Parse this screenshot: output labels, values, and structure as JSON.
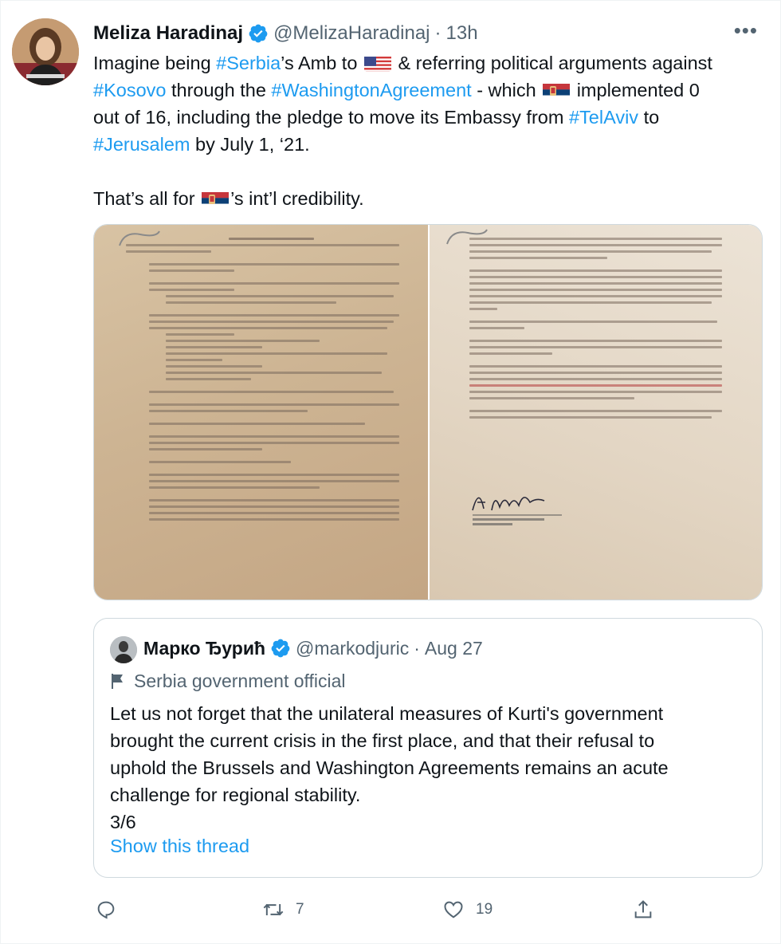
{
  "author": {
    "name": "Meliza Haradinaj",
    "handle": "@MelizaHaradinaj",
    "separator": "·",
    "time": "13h"
  },
  "more_label": "•••",
  "tweet": {
    "segments_line1": [
      "Imagine being ",
      "#Serbia",
      "’s Amb to ",
      " & referring political arguments against"
    ],
    "segments_line2": [
      "#Kosovo",
      " through the ",
      "#WashingtonAgreement",
      " - which ",
      " implemented 0"
    ],
    "segments_line3": [
      "out of 16, including the pledge to move its Embassy from ",
      "#TelAviv",
      " to"
    ],
    "segments_line4": [
      "#Jerusalem",
      " by July 1, ‘21."
    ],
    "segments_line5": [
      "That’s all for ",
      "’s int’l credibility."
    ]
  },
  "quote": {
    "name": "Марко Ђурић",
    "handle": "@markodjuric",
    "separator": "·",
    "time": "Aug 27",
    "label": "Serbia government official",
    "text_lines": [
      "Let us not forget that the unilateral measures of Kurti's government",
      "brought the current crisis in the first place, and that their refusal to",
      "uphold the Brussels and Washington Agreements remains an acute",
      "challenge for regional stability.",
      "3/6"
    ],
    "show_thread": "Show this thread"
  },
  "actions": {
    "retweets": "7",
    "likes": "19"
  },
  "colors": {
    "link": "#1d9bf0",
    "secondary": "#536471",
    "verified": "#1d9bf0"
  },
  "icons": [
    "verified-badge-icon",
    "more-icon",
    "government-flag-icon",
    "reply-icon",
    "retweet-icon",
    "like-icon",
    "share-icon",
    "us-flag-icon",
    "serbia-flag-icon"
  ]
}
